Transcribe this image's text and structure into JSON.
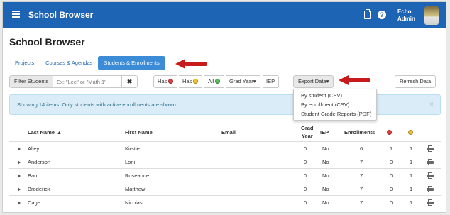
{
  "header": {
    "app_title": "School Browser",
    "user_first": "Echo",
    "user_last": "Admin",
    "icons": [
      "menu-icon",
      "clipboard-icon",
      "help-icon"
    ]
  },
  "page_title": "School Browser",
  "tabs": [
    {
      "label": "Projects",
      "active": false
    },
    {
      "label": "Courses & Agendas",
      "active": false
    },
    {
      "label": "Students & Enrollments",
      "active": true
    }
  ],
  "toolbar": {
    "filter_label": "Filter Students",
    "filter_placeholder": "Ex: \"Lee\" or \"Math 1\"",
    "clear_symbol": "✖",
    "has_red": "Has",
    "has_yellow": "Has",
    "all_green": "All",
    "grad_year": "Grad Year",
    "iep": "IEP",
    "export_data": "Export Data",
    "refresh_data": "Refresh Data"
  },
  "export_menu": {
    "items": [
      "By student (CSV)",
      "By enrollment (CSV)",
      "Student Grade Reports (PDF)"
    ]
  },
  "alert": {
    "text": "Showing 14 items. Only students with active enrollments are shown.",
    "close": "×"
  },
  "table": {
    "headers": {
      "last_name": "Last Name",
      "first_name": "First Name",
      "email": "Email",
      "grad": "Grad",
      "year": "Year",
      "iep": "IEP",
      "enrollments": "Enrollments"
    },
    "rows": [
      {
        "last": "Alley",
        "first": "Kirstie",
        "grad": "0",
        "iep": "No",
        "enrollments": "6",
        "red": "1",
        "yellow": "1"
      },
      {
        "last": "Anderson",
        "first": "Loni",
        "grad": "0",
        "iep": "No",
        "enrollments": "7",
        "red": "0",
        "yellow": "1"
      },
      {
        "last": "Barr",
        "first": "Roseanne",
        "grad": "0",
        "iep": "No",
        "enrollments": "7",
        "red": "0",
        "yellow": "1"
      },
      {
        "last": "Broderick",
        "first": "Matthew",
        "grad": "0",
        "iep": "No",
        "enrollments": "7",
        "red": "0",
        "yellow": "1"
      },
      {
        "last": "Cage",
        "first": "Nicolas",
        "grad": "0",
        "iep": "No",
        "enrollments": "7",
        "red": "0",
        "yellow": "1"
      }
    ]
  },
  "colors": {
    "header_blue": "#1e64b4",
    "red_dot": "#e8393b",
    "yellow_dot": "#f2c12e",
    "green_dot": "#5cb85c",
    "annotation_arrow": "#c71a1a"
  }
}
